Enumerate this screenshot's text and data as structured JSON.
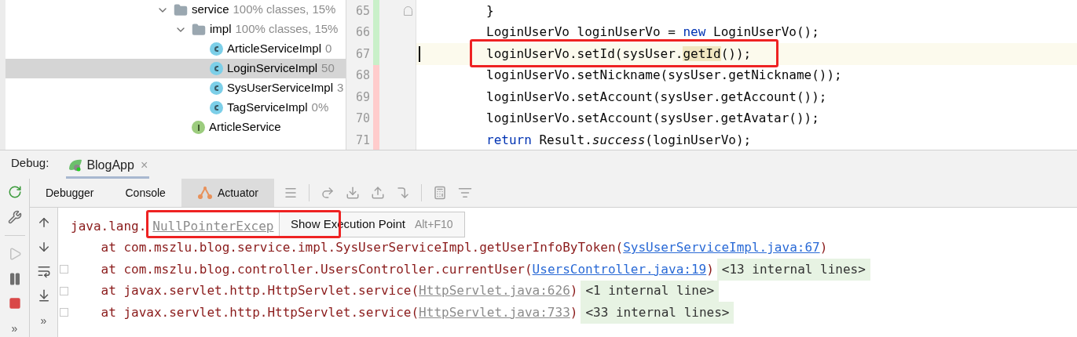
{
  "tree": [
    {
      "kind": "folder",
      "name": "service",
      "info": "100% classes, 15%",
      "expanded": true,
      "selected": false,
      "children": [
        {
          "kind": "folder",
          "name": "impl",
          "info": "100% classes, 15%",
          "expanded": true,
          "selected": false,
          "children": [
            {
              "kind": "class",
              "name": "ArticleServiceImpl",
              "info": "0",
              "selected": false
            },
            {
              "kind": "class",
              "name": "LoginServiceImpl",
              "info": "50",
              "selected": true
            },
            {
              "kind": "class",
              "name": "SysUserServiceImpl",
              "info": "3",
              "selected": false
            },
            {
              "kind": "class",
              "name": "TagServiceImpl",
              "info": "0%",
              "selected": false
            }
          ]
        },
        {
          "kind": "interface",
          "name": "ArticleService",
          "selected": false
        }
      ]
    }
  ],
  "editor": {
    "lines": [
      {
        "number": "65",
        "added": true,
        "current": false,
        "foldable": true,
        "segments": [
          {
            "kind": "plain",
            "text": "}"
          }
        ]
      },
      {
        "number": "66",
        "added": true,
        "current": false,
        "foldable": false,
        "segments": [
          {
            "kind": "plain",
            "text": "LoginUserVo loginUserVo = "
          },
          {
            "kind": "keyword",
            "text": "new"
          },
          {
            "kind": "plain",
            "text": " LoginUserVo();"
          }
        ]
      },
      {
        "number": "67",
        "added": true,
        "current": true,
        "foldable": false,
        "segments": [
          {
            "kind": "plain",
            "text": "loginUserVo.setId(sysUser."
          },
          {
            "kind": "match",
            "text": "getId"
          },
          {
            "kind": "plain",
            "text": "());"
          }
        ]
      },
      {
        "number": "68",
        "added": false,
        "current": false,
        "foldable": false,
        "segments": [
          {
            "kind": "plain",
            "text": "loginUserVo.setNickname(sysUser.getNickname());"
          }
        ]
      },
      {
        "number": "69",
        "added": false,
        "current": false,
        "foldable": false,
        "segments": [
          {
            "kind": "plain",
            "text": "loginUserVo.setAccount(sysUser.getAccount());"
          }
        ]
      },
      {
        "number": "70",
        "added": false,
        "current": false,
        "foldable": false,
        "segments": [
          {
            "kind": "plain",
            "text": "loginUserVo.setAccount(sysUser.getAvatar());"
          }
        ]
      },
      {
        "number": "71",
        "added": false,
        "current": false,
        "foldable": false,
        "segments": [
          {
            "kind": "keyword",
            "text": "return"
          },
          {
            "kind": "plain",
            "text": " Result."
          },
          {
            "kind": "italic",
            "text": "success"
          },
          {
            "kind": "plain",
            "text": "(loginUserVo);"
          }
        ]
      }
    ]
  },
  "debug": {
    "label": "Debug:",
    "session": {
      "title": "BlogApp",
      "close": "×"
    },
    "tabs": [
      {
        "label": "Debugger",
        "selected": false
      },
      {
        "label": "Console",
        "selected": false
      },
      {
        "label": "Actuator",
        "selected": true
      }
    ],
    "console": [
      {
        "foldable": false,
        "segments": [
          {
            "kind": "plain",
            "text": "java.lang."
          },
          {
            "kind": "muted-link",
            "text": "NullPointerExcep"
          }
        ]
      },
      {
        "foldable": false,
        "segments": [
          {
            "kind": "plain",
            "text": "    at com.mszlu.blog.service.impl.SysUserServiceImpl.getUserInfoByToken("
          },
          {
            "kind": "link",
            "text": "SysUserServiceImpl.java:67"
          },
          {
            "kind": "plain",
            "text": ")"
          }
        ]
      },
      {
        "foldable": true,
        "segments": [
          {
            "kind": "plain",
            "text": "    at com.mszlu.blog.controller.UsersController.currentUser("
          },
          {
            "kind": "link",
            "text": "UsersController.java:19"
          },
          {
            "kind": "plain",
            "text": ")"
          },
          {
            "kind": "internal",
            "text": "<13 internal lines>"
          }
        ]
      },
      {
        "foldable": true,
        "segments": [
          {
            "kind": "plain",
            "text": "    at javax.servlet.http.HttpServlet.service("
          },
          {
            "kind": "muted-link",
            "text": "HttpServlet.java:626"
          },
          {
            "kind": "plain",
            "text": ")"
          },
          {
            "kind": "internal",
            "text": "<1 internal line>"
          }
        ]
      },
      {
        "foldable": true,
        "segments": [
          {
            "kind": "plain",
            "text": "    at javax.servlet.http.HttpServlet.service("
          },
          {
            "kind": "muted-link",
            "text": "HttpServlet.java:733"
          },
          {
            "kind": "plain",
            "text": ")"
          },
          {
            "kind": "internal",
            "text": "<33 internal lines>"
          }
        ]
      }
    ],
    "tooltip": {
      "label": "Show Execution Point",
      "shortcut": "Alt+F10"
    },
    "more": [
      "»",
      "»"
    ]
  }
}
